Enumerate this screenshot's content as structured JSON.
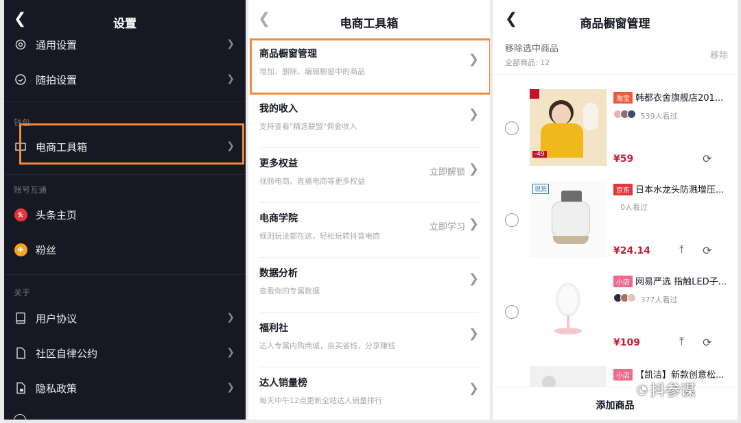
{
  "panel1": {
    "title": "设置",
    "items": [
      {
        "label": "通用设置"
      },
      {
        "label": "随拍设置"
      },
      {
        "label": "电商工具箱"
      },
      {
        "label": "头条主页"
      },
      {
        "label": "粉丝"
      },
      {
        "label": "用户协议"
      },
      {
        "label": "社区自律公约"
      },
      {
        "label": "隐私政策"
      }
    ],
    "sections": [
      "钱包",
      "账号互通",
      "关于"
    ]
  },
  "panel2": {
    "title": "电商工具箱",
    "items": [
      {
        "title": "商品橱窗管理",
        "sub": "增加、删除、编辑橱窗中的商品",
        "right": ""
      },
      {
        "title": "我的收入",
        "sub": "支持查看\"精选联盟\"佣金收入",
        "right": ""
      },
      {
        "title": "更多权益",
        "sub": "视频电商、直播电商等更多权益",
        "right": "立即解锁"
      },
      {
        "title": "电商学院",
        "sub": "规则玩法都在这，轻松玩转抖音电商",
        "right": "立即学习"
      },
      {
        "title": "数据分析",
        "sub": "查看你的专属数据",
        "right": ""
      },
      {
        "title": "福利社",
        "sub": "达人专属内购商城，自买省钱，分享赚钱",
        "right": ""
      },
      {
        "title": "达人销量榜",
        "sub": "每天中午12点更新全站达人销量排行",
        "right": ""
      }
    ]
  },
  "panel3": {
    "title": "商品橱窗管理",
    "remove_selected": "移除选中商品",
    "total": "全部商品: 12",
    "remove": "移除",
    "products": [
      {
        "tag": "淘宝",
        "tag_color": "#ef5b3a",
        "title": "韩都衣舍旗舰店201...",
        "views": "539人看过",
        "price": "¥59",
        "thumb_tag": "-49"
      },
      {
        "tag": "京东",
        "tag_color": "#e0383e",
        "title": "日本水龙头防溅增压...",
        "views": "0人看过",
        "price": "¥24.14",
        "thumb_tag": "现货"
      },
      {
        "tag": "小店",
        "tag_color": "#f06a8a",
        "title": "网易严选 指触LED子...",
        "views": "377人看过",
        "price": "¥109",
        "thumb_tag": ""
      },
      {
        "tag": "小店",
        "tag_color": "#f06a8a",
        "title": "【凯洁】新款创意松...",
        "views": "",
        "price": "",
        "thumb_tag": ""
      }
    ],
    "add_button": "添加商品",
    "watermark": "抖参谋"
  }
}
